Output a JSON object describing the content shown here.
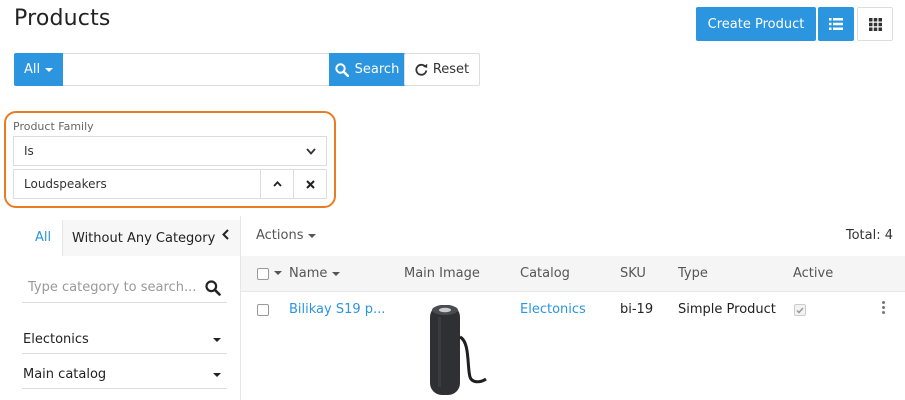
{
  "header": {
    "title": "Products",
    "create_label": "Create Product"
  },
  "search": {
    "scope_label": "All",
    "query": "",
    "search_label": "Search",
    "reset_label": "Reset"
  },
  "filter": {
    "field_label": "Product Family",
    "operator": "Is",
    "value": "Loudspeakers"
  },
  "categories": {
    "tab_all": "All",
    "tab_without": "Without Any Category",
    "search_placeholder": "Type category to search...",
    "items": [
      {
        "label": "Electonics"
      },
      {
        "label": "Main catalog"
      }
    ]
  },
  "list": {
    "actions_label": "Actions",
    "total_label": "Total: 4",
    "columns": [
      "Name",
      "Main Image",
      "Catalog",
      "SKU",
      "Type",
      "Active"
    ],
    "rows": [
      {
        "name": "Bilikay S19 p...",
        "catalog": "Electonics",
        "sku": "bi-19",
        "type": "Simple Product",
        "active": true
      }
    ]
  },
  "colors": {
    "accent": "#2b95e0",
    "highlight": "#ea7b23"
  },
  "icons": {
    "search": "search-icon",
    "reset": "refresh-icon",
    "list_view": "list-icon",
    "grid_view": "grid-icon"
  }
}
